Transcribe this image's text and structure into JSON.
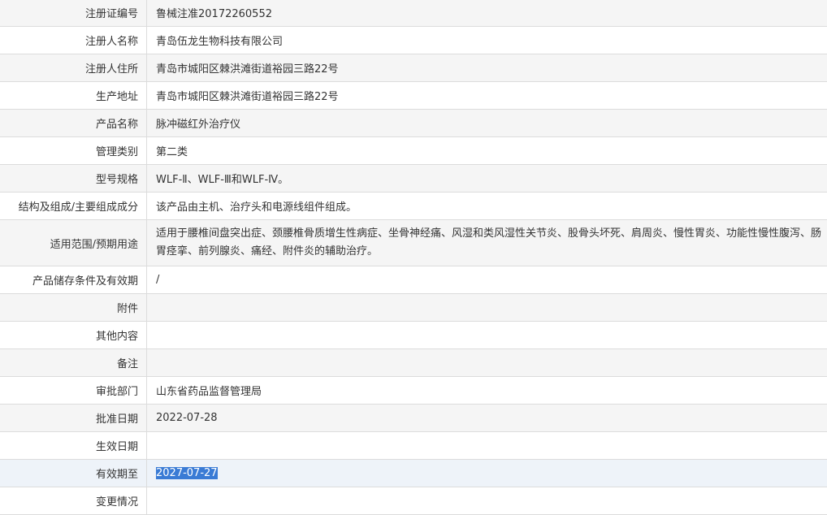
{
  "rows": [
    {
      "label": "注册证编号",
      "value": "鲁械注准20172260552"
    },
    {
      "label": "注册人名称",
      "value": "青岛伍龙生物科技有限公司"
    },
    {
      "label": "注册人住所",
      "value": "青岛市城阳区棘洪滩街道裕园三路22号"
    },
    {
      "label": "生产地址",
      "value": "青岛市城阳区棘洪滩街道裕园三路22号"
    },
    {
      "label": "产品名称",
      "value": "脉冲磁红外治疗仪"
    },
    {
      "label": "管理类别",
      "value": "第二类"
    },
    {
      "label": "型号规格",
      "value": "WLF-Ⅱ、WLF-Ⅲ和WLF-Ⅳ。"
    },
    {
      "label": "结构及组成/主要组成成分",
      "value": "该产品由主机、治疗头和电源线组件组成。"
    },
    {
      "label": "适用范围/预期用途",
      "value": "适用于腰椎间盘突出症、颈腰椎骨质增生性病症、坐骨神经痛、风湿和类风湿性关节炎、股骨头坏死、肩周炎、慢性胃炎、功能性慢性腹泻、肠胃痉挛、前列腺炎、痛经、附件炎的辅助治疗。"
    },
    {
      "label": "产品储存条件及有效期",
      "value": "/"
    },
    {
      "label": "附件",
      "value": ""
    },
    {
      "label": "其他内容",
      "value": ""
    },
    {
      "label": "备注",
      "value": ""
    },
    {
      "label": "审批部门",
      "value": "山东省药品监督管理局"
    },
    {
      "label": "批准日期",
      "value": "2022-07-28"
    },
    {
      "label": "生效日期",
      "value": ""
    },
    {
      "label": "有效期至",
      "value": "2027-07-27"
    },
    {
      "label": "变更情况",
      "value": ""
    }
  ]
}
